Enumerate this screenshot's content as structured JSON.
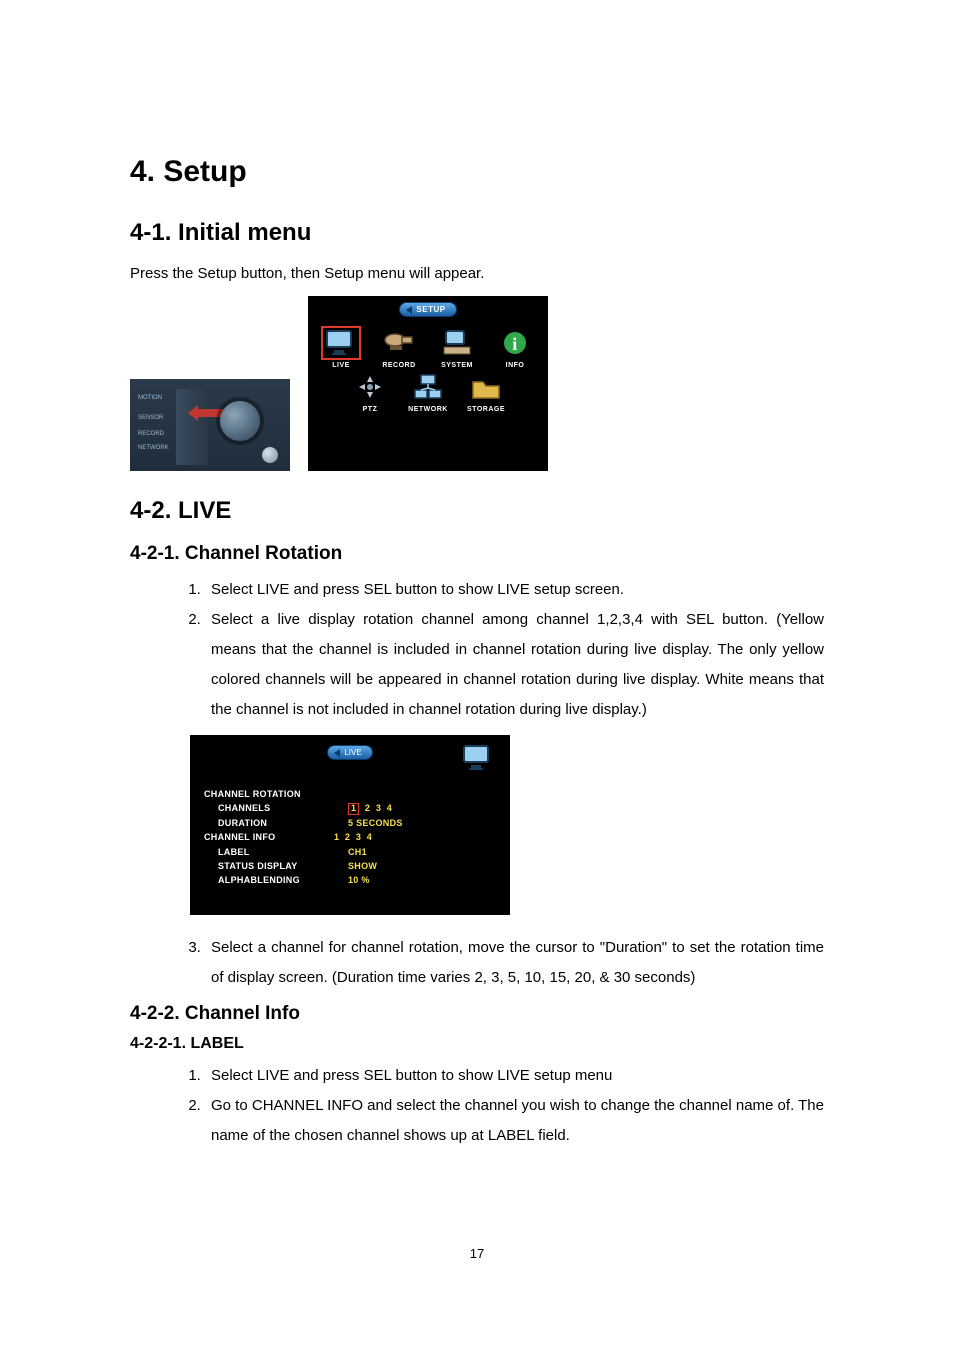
{
  "headings": {
    "h1": "4. Setup",
    "h2_1": "4-1. Initial menu",
    "h2_2": "4-2. LIVE",
    "h3_1": "4-2-1. Channel Rotation",
    "h3_2": "4-2-2. Channel Info",
    "h4_1": "4-2-2-1. LABEL"
  },
  "para": {
    "p1": "Press the Setup button, then Setup menu will appear."
  },
  "hw": {
    "motion": "MOTION",
    "sensor": "SENSOR",
    "record": "RECORD",
    "network": "NETWORK"
  },
  "setup_menu": {
    "title": "SETUP",
    "items": [
      {
        "label": "LIVE"
      },
      {
        "label": "RECORD"
      },
      {
        "label": "SYSTEM"
      },
      {
        "label": "INFO"
      },
      {
        "label": "PTZ"
      },
      {
        "label": "NETWORK"
      },
      {
        "label": "STORAGE"
      }
    ]
  },
  "steps_rotation": {
    "s1": "Select LIVE and press SEL button to show LIVE setup screen.",
    "s2": "Select a live display rotation channel among channel 1,2,3,4 with SEL button.   (Yellow means that the channel is included in channel rotation during live display. The only yellow colored channels will be appeared in channel rotation during live display. White means that the channel is not included in channel rotation during live display.)",
    "s3": "Select a channel for channel rotation, move the cursor to \"Duration\" to set the rotation time of display screen. (Duration time varies 2, 3, 5, 10, 15, 20, & 30 seconds)"
  },
  "live_menu": {
    "title": "LIVE",
    "rows": {
      "channel_rotation": "CHANNEL ROTATION",
      "channels_label": "CHANNELS",
      "ch1": "1",
      "ch_rest": "  2  3  4",
      "duration_label": "DURATION",
      "duration_value": "5 SECONDS",
      "channel_info": "CHANNEL INFO",
      "channel_info_vals": "1  2  3  4",
      "label_label": "LABEL",
      "label_value": "CH1",
      "status_label": "STATUS DISPLAY",
      "status_value": "SHOW",
      "alpha_label": "ALPHABLENDING",
      "alpha_value": "10 %"
    }
  },
  "steps_label": {
    "s1": "Select LIVE and press SEL button to show LIVE setup menu",
    "s2": "Go to CHANNEL INFO and select the channel you wish to change the channel name of. The name of the chosen channel shows up at LABEL field."
  },
  "page_number": "17"
}
